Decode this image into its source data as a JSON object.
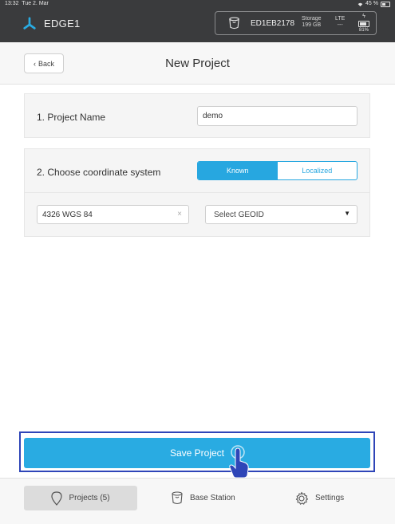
{
  "status_bar": {
    "time": "13:32",
    "date": "Tue 2. Mar",
    "battery_pct": "45 %"
  },
  "header": {
    "app_title": "EDGE1",
    "device_id": "ED1EB2178",
    "storage_label": "Storage",
    "storage_value": "199 GB",
    "lte_label": "LTE",
    "lte_value": "---",
    "battery": "81%"
  },
  "nav": {
    "back_label": "Back",
    "title": "New Project"
  },
  "form": {
    "project_name_label": "1. Project Name",
    "project_name_value": "demo",
    "coordinate_label": "2. Choose coordinate system",
    "coordinate_options": [
      "Known",
      "Localized"
    ],
    "coordinate_selected": "Known",
    "crs_value": "4326 WGS 84",
    "clear_symbol": "×",
    "geoid_placeholder": "Select GEOID"
  },
  "actions": {
    "save_label": "Save Project"
  },
  "tabs": [
    {
      "label": "Projects (5)",
      "icon": "map-pin-icon",
      "active": true
    },
    {
      "label": "Base Station",
      "icon": "base-station-icon",
      "active": false
    },
    {
      "label": "Settings",
      "icon": "gear-icon",
      "active": false
    }
  ],
  "colors": {
    "accent": "#29abe2",
    "header_bg": "#3a3b3d",
    "highlight_border": "#2e45b8"
  }
}
